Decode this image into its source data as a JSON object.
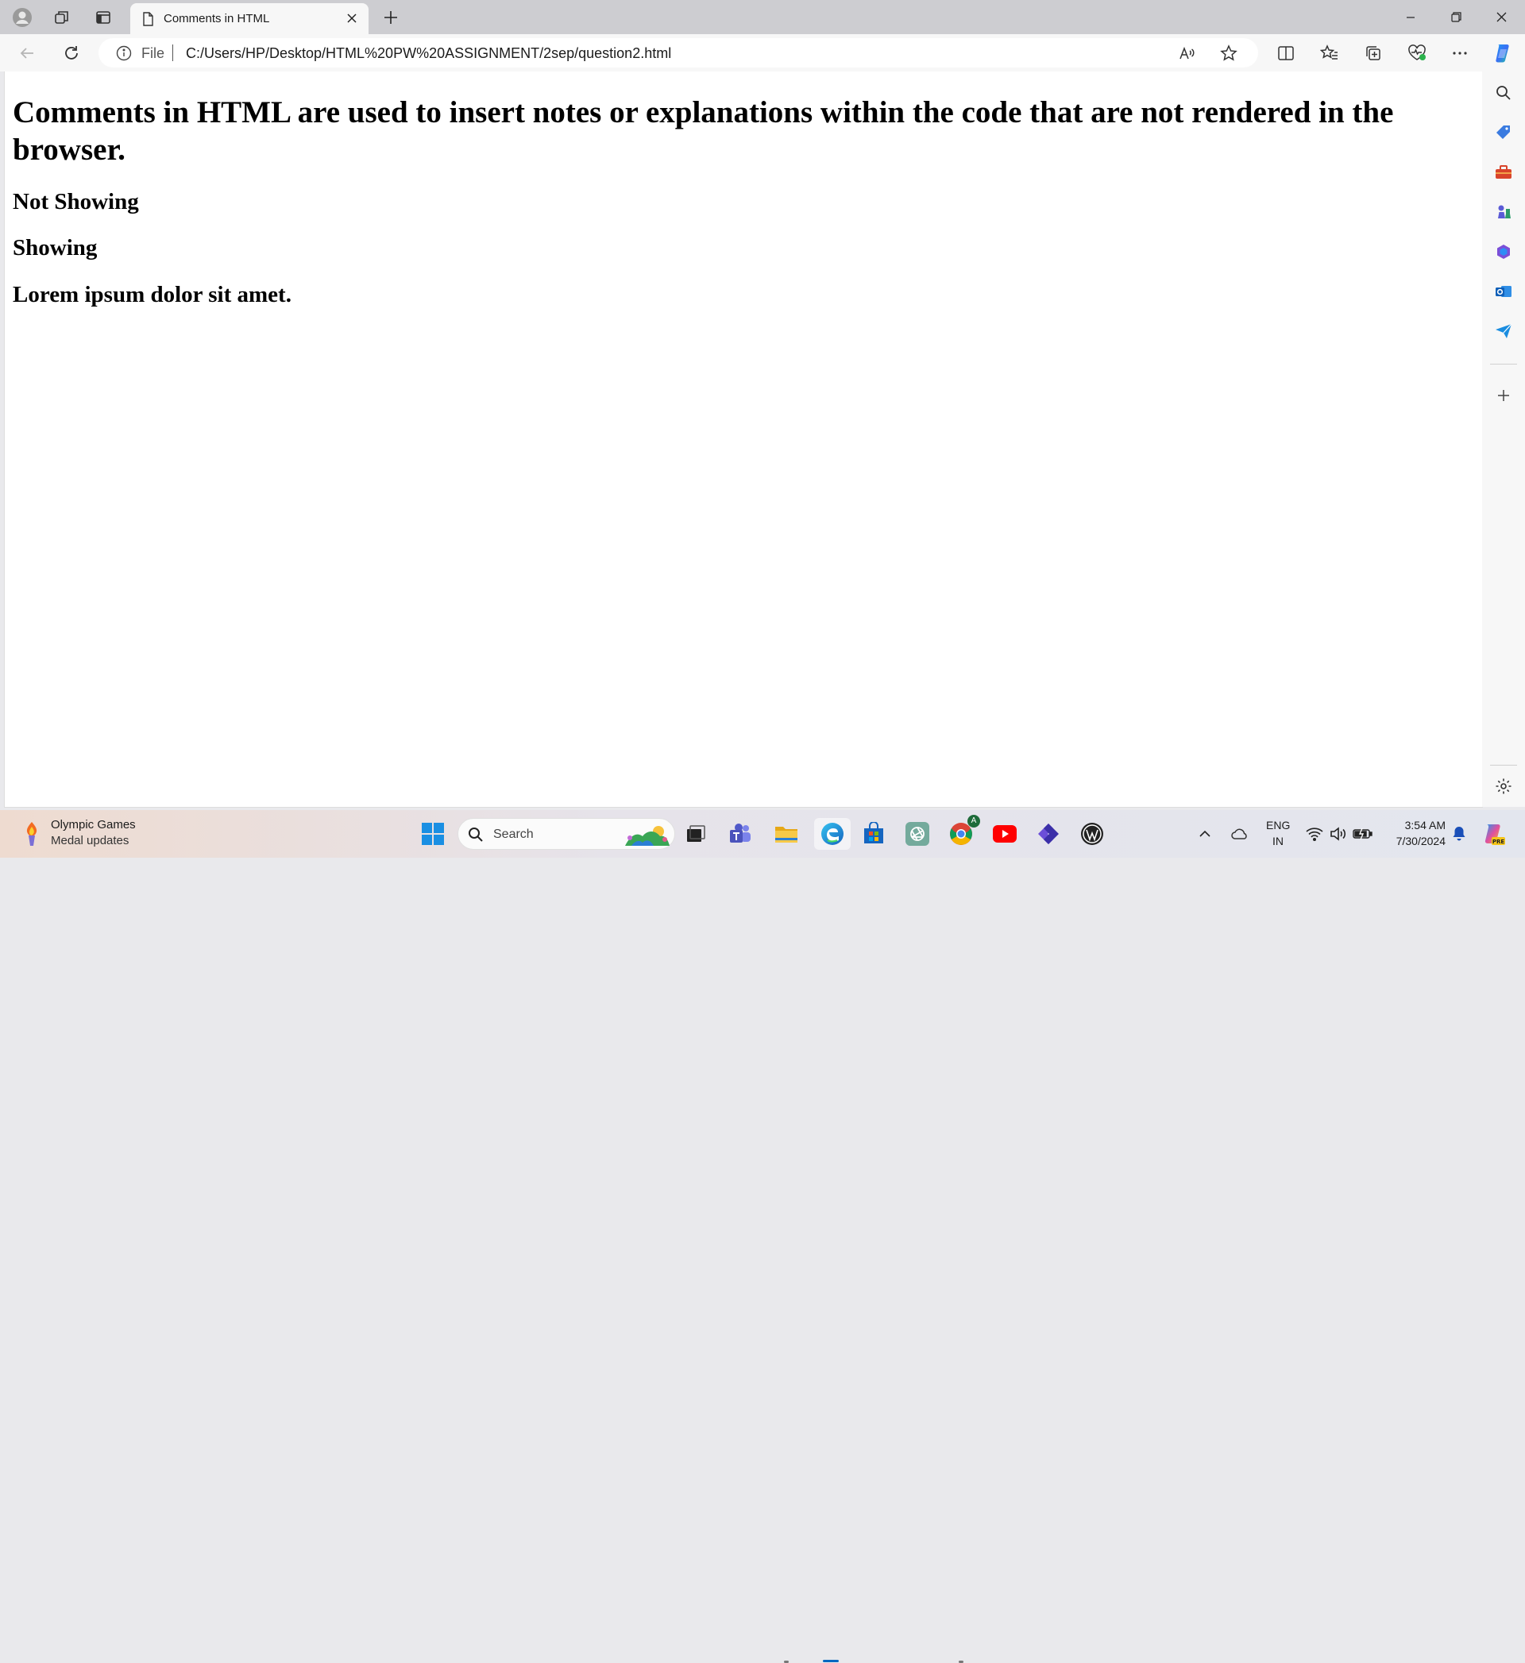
{
  "browser": {
    "tab": {
      "title": "Comments in HTML",
      "icon": "document-icon"
    },
    "address": {
      "scheme_label": "File",
      "url": "C:/Users/HP/Desktop/HTML%20PW%20ASSIGNMENT/2sep/question2.html"
    }
  },
  "page": {
    "heading": "Comments in HTML are used to insert notes or explanations within the code that are not rendered in the browser.",
    "lines": [
      "Not Showing",
      "Showing",
      "Lorem ipsum dolor sit amet."
    ]
  },
  "taskbar": {
    "widget": {
      "title": "Olympic Games",
      "subtitle": "Medal updates"
    },
    "search_label": "Search",
    "lang_top": "ENG",
    "lang_bottom": "IN",
    "time": "3:54 AM",
    "date": "7/30/2024",
    "chrome_badge": "A"
  },
  "colors": {
    "accent": "#0067c0",
    "titlebar": "#cdcdd1",
    "toolbar": "#f7f7f7"
  }
}
